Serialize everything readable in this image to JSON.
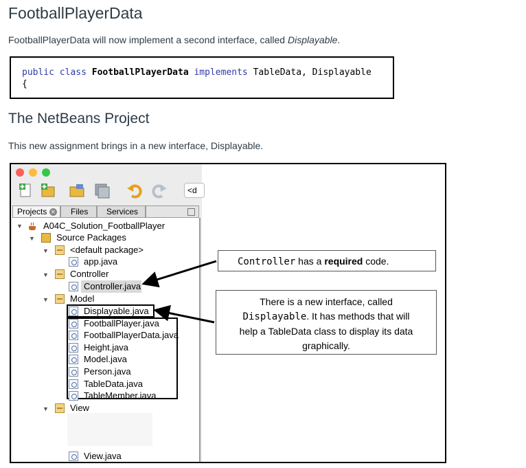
{
  "heading1": "FootballPlayerData",
  "intro": {
    "text": "FootballPlayerData will now implement a second interface, called ",
    "emph": "Displayable",
    "end": "."
  },
  "code": {
    "kw1": "public",
    "kw2": "class",
    "classname": "FootballPlayerData",
    "kw3": "implements",
    "interfaces": "TableData, Displayable",
    "brace": "{"
  },
  "heading2": "The NetBeans Project",
  "para2": "This new assignment brings in a new interface, Displayable.",
  "colors": {
    "close": "#fc605b",
    "minimize": "#fdbc40",
    "zoom": "#34c84a",
    "keyword": "#2f3ba8"
  },
  "ide": {
    "toolbar_field": "<d",
    "tabs": {
      "projects": "Projects",
      "files": "Files",
      "services": "Services"
    },
    "project": "A04C_Solution_FootballPlayer",
    "source_packages": "Source Packages",
    "default_package": "<default package>",
    "app_file": "app.java",
    "controller_pkg": "Controller",
    "controller_file": "Controller.java",
    "model_pkg": "Model",
    "model_files": [
      "Displayable.java",
      "FootballPlayer.java",
      "FootballPlayerData.java",
      "Height.java",
      "Model.java",
      "Person.java",
      "TableData.java",
      "TableMember.java"
    ],
    "view_pkg": "View",
    "view_file": "View.java"
  },
  "callout1": {
    "code": "Controller",
    "text1": " has a ",
    "bold": "required",
    "text2": " code."
  },
  "callout2": {
    "line1": "There is a new interface, called",
    "code": "Displayable",
    "line2a": ". It has methods that will",
    "line3": "help a TableData class to display its data",
    "line4": "graphically."
  }
}
